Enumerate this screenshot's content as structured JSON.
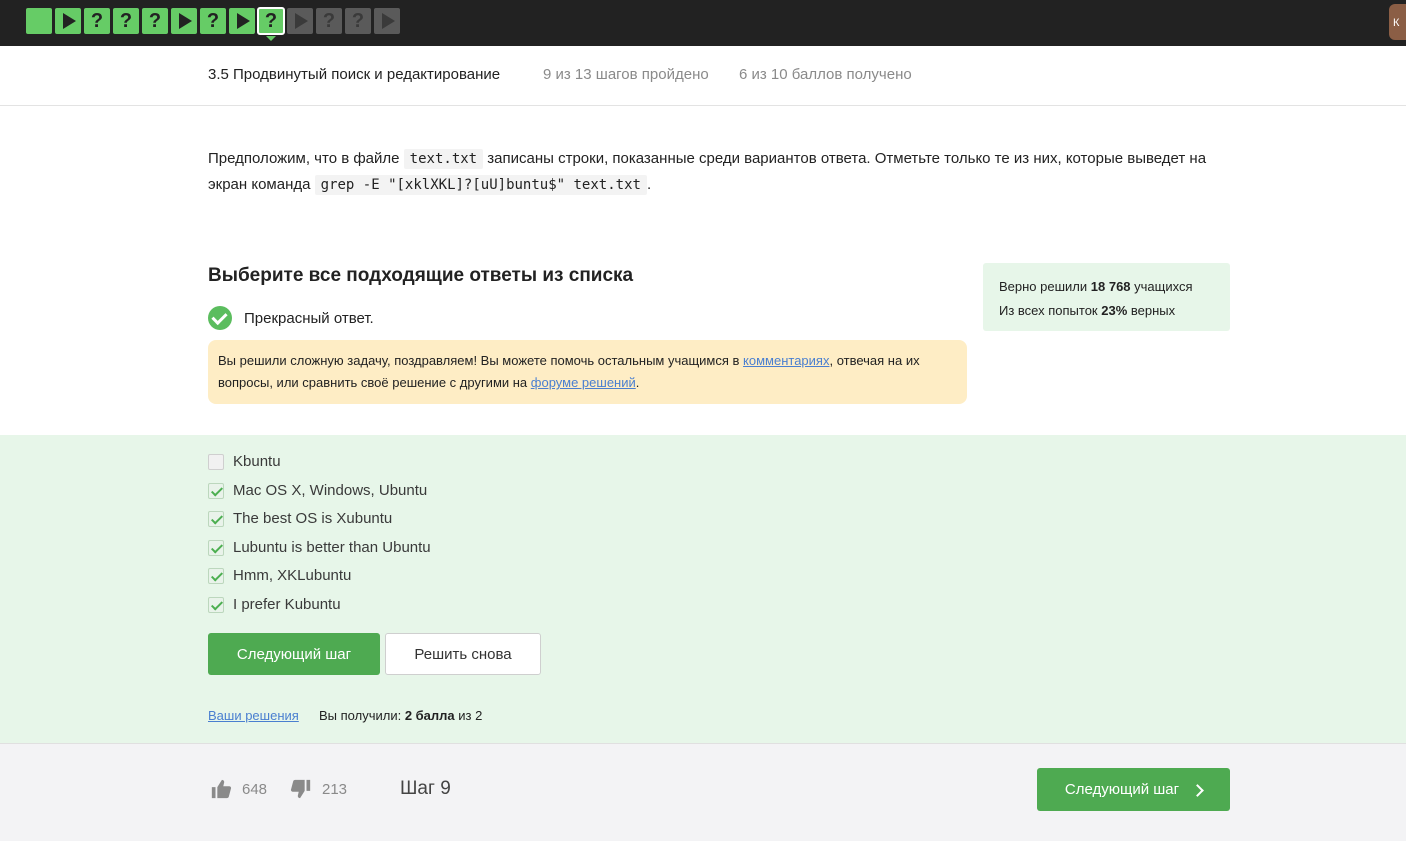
{
  "steps": [
    {
      "type": "done-empty"
    },
    {
      "type": "done-play"
    },
    {
      "type": "done-quiz",
      "label": "?"
    },
    {
      "type": "done-quiz",
      "label": "?"
    },
    {
      "type": "done-quiz",
      "label": "?"
    },
    {
      "type": "done-play"
    },
    {
      "type": "done-quiz",
      "label": "?"
    },
    {
      "type": "done-play"
    },
    {
      "type": "current-quiz",
      "label": "?"
    },
    {
      "type": "todo-play"
    },
    {
      "type": "todo-quiz",
      "label": "?"
    },
    {
      "type": "todo-quiz",
      "label": "?"
    },
    {
      "type": "todo-play"
    }
  ],
  "header": {
    "lesson_title": "3.5 Продвинутый поиск и редактирование",
    "progress": "9 из 13 шагов пройдено",
    "score": "6 из 10 баллов  получено"
  },
  "question": {
    "part1": "Предположим, что в файле ",
    "code1": "text.txt",
    "part2": " записаны строки, показанные среди вариантов ответа. Отметьте только те из них, которые выведет на экран команда ",
    "code2": "grep -E \"[xklXKL]?[uU]buntu$\" text.txt",
    "part3": "."
  },
  "choose_title": "Выберите все подходящие ответы из списка",
  "stats": {
    "line1_prefix": "Верно решили ",
    "line1_count": "18 768",
    "line1_suffix": " учащихся",
    "line2_prefix": "Из всех попыток ",
    "line2_percent": "23%",
    "line2_suffix": " верных"
  },
  "feedback": {
    "ok_text": "Прекрасный ответ.",
    "notice_part1": "Вы решили сложную задачу, поздравляем! Вы можете помочь остальным учащимся в ",
    "notice_link1": "комментариях",
    "notice_part2": ", отвечая на их вопросы, или сравнить своё решение с другими на ",
    "notice_link2": "форуме решений",
    "notice_part3": "."
  },
  "options": [
    {
      "label": "Kbuntu",
      "checked": false
    },
    {
      "label": "Mac OS X, Windows, Ubuntu",
      "checked": true
    },
    {
      "label": "The best OS is Xubuntu",
      "checked": true
    },
    {
      "label": "Lubuntu is better than Ubuntu",
      "checked": true
    },
    {
      "label": "Hmm, XKLubuntu",
      "checked": true
    },
    {
      "label": "I prefer Kubuntu",
      "checked": true
    }
  ],
  "actions": {
    "next_label": "Следующий шаг",
    "retry_label": "Решить снова",
    "your_solutions": "Ваши решения",
    "result_prefix": "Вы получили: ",
    "result_points": "2 балла",
    "result_suffix": " из 2"
  },
  "footer": {
    "likes": "648",
    "dislikes": "213",
    "step_label": "Шаг 9",
    "next_label": "Следующий шаг"
  },
  "colors": {
    "topbar": "#222222",
    "step_done": "#66cc66",
    "step_todo": "#5a5a5a",
    "accent_green": "#4eaa51",
    "answers_bg": "#e7f6e9",
    "notice_bg": "#feedc5",
    "link": "#4a7fd0"
  }
}
